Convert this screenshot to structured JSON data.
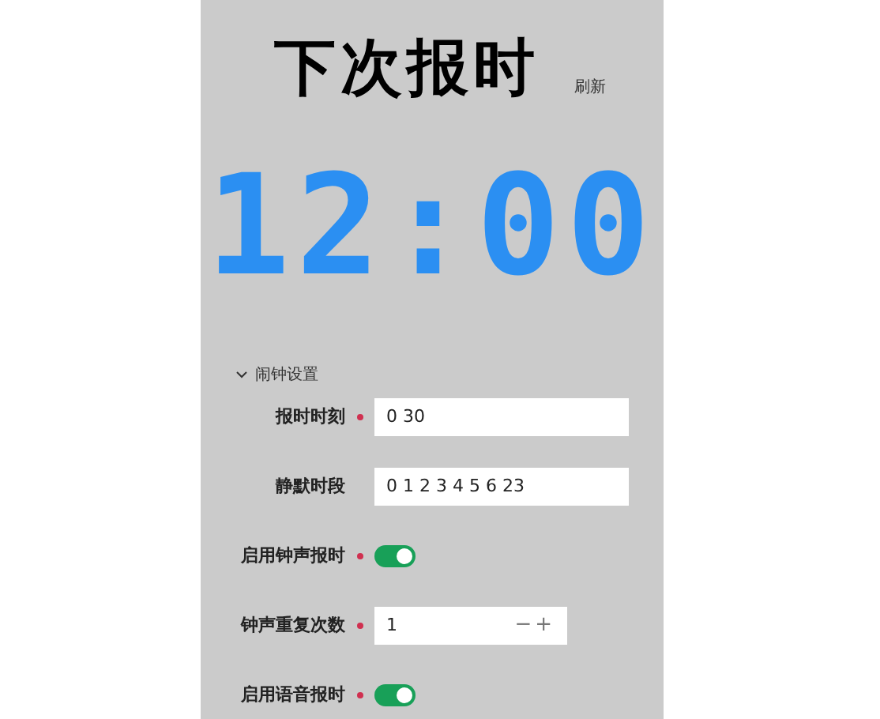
{
  "header": {
    "title": "下次报时",
    "refresh_link": "刷新"
  },
  "clock": {
    "time": "12:00"
  },
  "section": {
    "title": "闹钟设置",
    "expanded": true
  },
  "fields": [
    {
      "kind": "text",
      "label": "报时时刻",
      "required": true,
      "value": "0 30"
    },
    {
      "kind": "text",
      "label": "静默时段",
      "required": false,
      "value": "0 1 2 3 4 5 6 23"
    },
    {
      "kind": "switch",
      "label": "启用钟声报时",
      "required": true,
      "on": true
    },
    {
      "kind": "number",
      "label": "钟声重复次数",
      "required": true,
      "value": "1",
      "minus": "−",
      "plus": "+"
    },
    {
      "kind": "switch",
      "label": "启用语音报时",
      "required": true,
      "on": true
    }
  ]
}
